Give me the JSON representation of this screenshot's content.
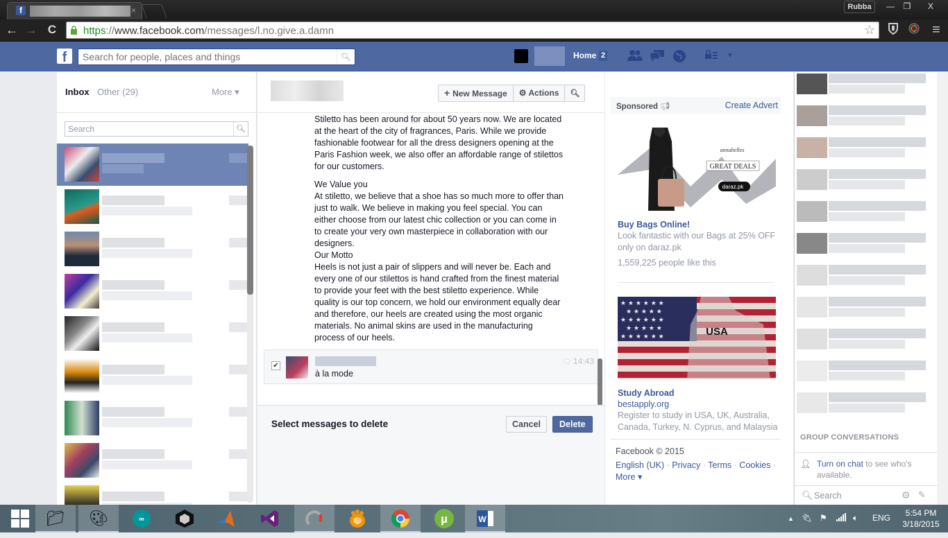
{
  "browser": {
    "tab_close": "×",
    "profile_name": "Rubba",
    "window_buttons": {
      "minimize": "—",
      "restore": "❐",
      "close": "X"
    },
    "url": {
      "scheme": "https",
      "sep": "://",
      "host": "www.facebook.com",
      "path": "/messages/l.no.give.a.damn"
    },
    "nav": {
      "back": "←",
      "forward": "→",
      "reload": "C"
    },
    "star": "☆"
  },
  "fb_header": {
    "logo": "f",
    "search_placeholder": "Search for people, places and things",
    "home_label": "Home",
    "home_count": "2"
  },
  "inbox": {
    "tab_inbox": "Inbox",
    "tab_other": "Other (29)",
    "tab_more": "More ▾",
    "search_placeholder": "Search",
    "thread_count": 9
  },
  "conversation": {
    "buttons": {
      "new_message": "New Message",
      "actions": "Actions"
    },
    "paragraphs": [
      "Stiletto has been around for about 50 years now. We are located at the heart of the city of fragrances, Paris. While we provide fashionable footwear for all the dress designers opening at the Paris Fashion week, we also offer an affordable range of stilettos for our customers.",
      "We Value you",
      "At stiletto, we believe that a shoe has so much more to offer than just to walk. We believe in making you feel special. You can either choose from our latest chic collection or you can come in to create your very own masterpiece in collaboration with our designers.",
      "Our Motto",
      "Heels is not just a pair of slippers and will never be. Each and every one of our stilettos is hand crafted from the finest material to provide your feet with the best stiletto experience. While quality is our top concern, we hold our environment equally dear and therefore, our heels are created using the most organic materials. No animal skins are used in the manufacturing process of our heels."
    ],
    "selected_message": {
      "text": "à la mode",
      "time": "14:43",
      "checked": true
    },
    "delete_bar": {
      "label": "Select messages to delete",
      "cancel": "Cancel",
      "delete": "Delete"
    }
  },
  "ads": {
    "sponsored": "Sponsored",
    "create_advert": "Create Advert",
    "items": [
      {
        "title": "Buy Bags Online!",
        "text": "Look fantastic with our Bags at 25% OFF only on daraz.pk",
        "likes": "1,559,225 people like this",
        "image_text": {
          "brand": "annabelles",
          "deal": "GREAT DEALS",
          "store": "daraz.pk"
        }
      },
      {
        "title": "Study Abroad",
        "domain": "bestapply.org",
        "text": "Register to study in USA, UK, Australia, Canada, Turkey, N. Cyprus, and Malaysia",
        "image_text": {
          "shirt": "USA"
        }
      }
    ],
    "footer": {
      "copyright": "Facebook © 2015",
      "links": [
        "English (UK)",
        "Privacy",
        "Terms",
        "Cookies"
      ],
      "more": "More ▾"
    }
  },
  "chat": {
    "group_conversations": "GROUP CONVERSATIONS",
    "turn_on_link": "Turn on chat",
    "turn_on_rest": " to see who's available.",
    "search_placeholder": "Search"
  },
  "taskbar": {
    "apps": [
      "Start",
      "File Explorer",
      "Paint",
      "Arduino",
      "Unity",
      "MATLAB",
      "Visual Studio",
      "Camtasia",
      "GOM Player",
      "Google Chrome",
      "uTorrent",
      "Microsoft Word"
    ],
    "language": "ENG",
    "time": "5:54 PM",
    "date": "3/18/2015"
  }
}
